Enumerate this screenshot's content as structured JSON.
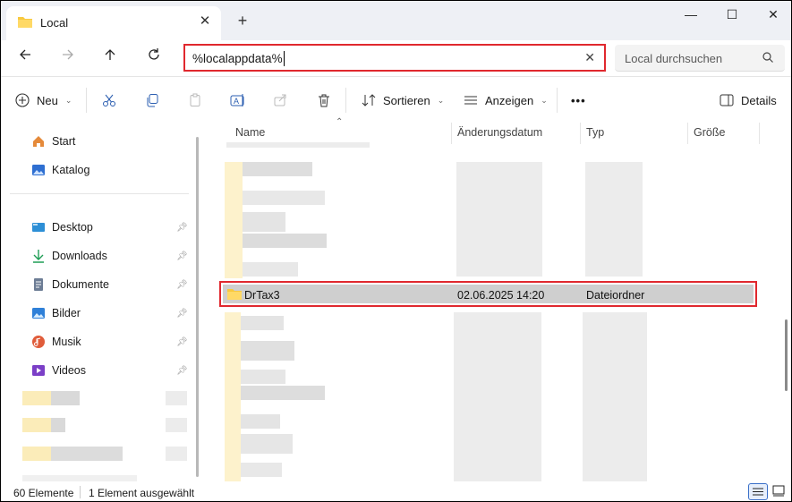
{
  "window": {
    "tab_title": "Local",
    "new_tab_symbol": "+",
    "close_tab_symbol": "✕",
    "minimize_symbol": "—",
    "maximize_symbol": "☐",
    "close_symbol": "✕"
  },
  "navigation": {
    "address_value": "%localappdata%",
    "search_placeholder": "Local durchsuchen"
  },
  "toolbar": {
    "new_label": "Neu",
    "sort_label": "Sortieren",
    "view_label": "Anzeigen",
    "more_label": "•••",
    "details_label": "Details"
  },
  "sidebar": {
    "top_items": [
      {
        "label": "Start",
        "icon": "home-icon"
      },
      {
        "label": "Katalog",
        "icon": "gallery-icon"
      }
    ],
    "pinned_items": [
      {
        "label": "Desktop",
        "icon": "desktop-icon"
      },
      {
        "label": "Downloads",
        "icon": "download-icon"
      },
      {
        "label": "Dokumente",
        "icon": "document-icon"
      },
      {
        "label": "Bilder",
        "icon": "pictures-icon"
      },
      {
        "label": "Musik",
        "icon": "music-icon"
      },
      {
        "label": "Videos",
        "icon": "video-icon"
      }
    ]
  },
  "file_list": {
    "columns": [
      "Name",
      "Änderungsdatum",
      "Typ",
      "Größe"
    ],
    "selected_row": {
      "name": "DrTax3",
      "modified": "02.06.2025 14:20",
      "type": "Dateiordner",
      "size": ""
    }
  },
  "status_bar": {
    "item_count": "60 Elemente",
    "selection": "1 Element ausgewählt"
  },
  "colors": {
    "highlight_border": "#e0282e",
    "selection_fill": "#cfcfcf",
    "folder_yellow": "#f8c93f"
  }
}
